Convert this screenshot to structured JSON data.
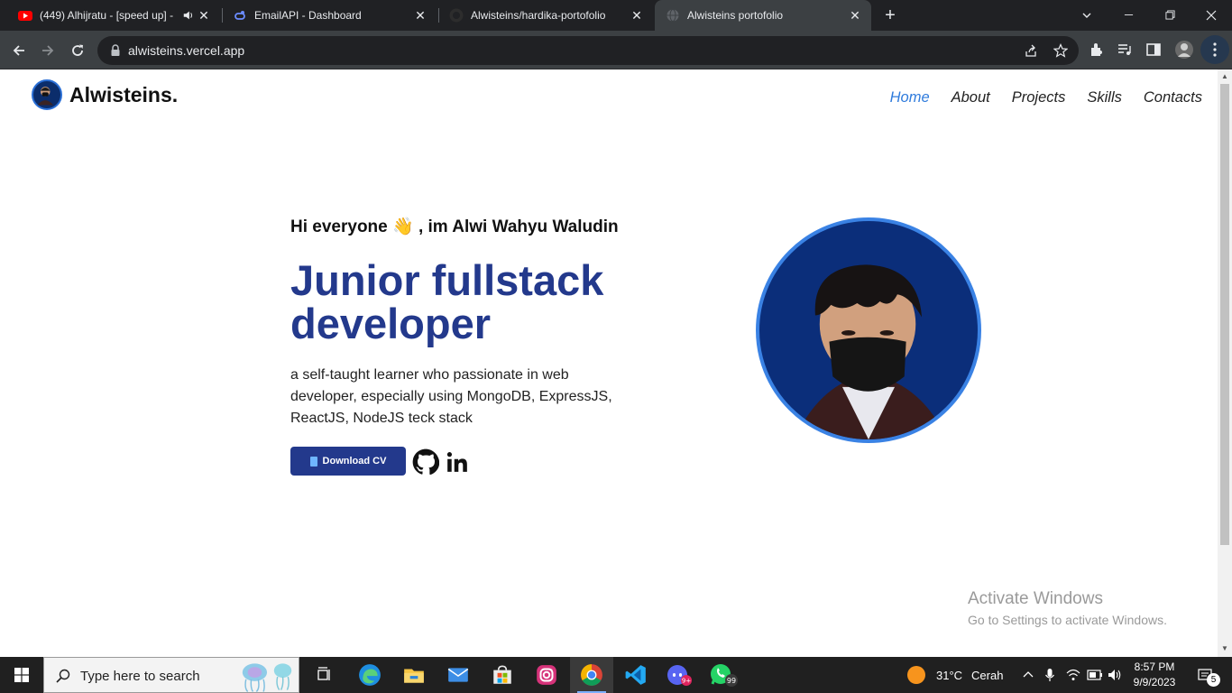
{
  "browser": {
    "tabs": [
      {
        "title": "(449) Alhijratu - [speed up] -",
        "icon": "youtube-icon",
        "audio": true
      },
      {
        "title": "EmailAPI - Dashboard",
        "icon": "emailapi-icon"
      },
      {
        "title": "Alwisteins/hardika-portofolio",
        "icon": "github-icon"
      },
      {
        "title": "Alwisteins portofolio",
        "icon": "globe-icon",
        "active": true
      }
    ],
    "new_tab": "+",
    "url": "alwisteins.vercel.app"
  },
  "site": {
    "brand": "Alwisteins.",
    "nav": [
      {
        "label": "Home",
        "active": true
      },
      {
        "label": "About"
      },
      {
        "label": "Projects"
      },
      {
        "label": "Skills"
      },
      {
        "label": "Contacts"
      }
    ],
    "greeting_before": "Hi everyone ",
    "greeting_emoji": "👋",
    "greeting_after": " , im Alwi Wahyu Waludin",
    "headline": "Junior fullstack developer",
    "description": "a self-taught learner who passionate in web developer, especially using MongoDB, ExpressJS, ReactJS, NodeJS teck stack",
    "cv_button": "Download CV",
    "social": [
      "github-icon",
      "linkedin-icon"
    ]
  },
  "watermark": {
    "line1": "Activate Windows",
    "line2": "Go to Settings to activate Windows."
  },
  "taskbar": {
    "search_placeholder": "Type here to search",
    "weather_temp": "31°C",
    "weather_desc": "Cerah",
    "time": "8:57 PM",
    "date": "9/9/2023",
    "whatsapp_badge": "99",
    "discord_badge": "9+",
    "notifications": "5"
  },
  "colors": {
    "accent": "#23398c",
    "nav_active": "#2f7bdc",
    "avatar_ring": "#3a82e4"
  }
}
